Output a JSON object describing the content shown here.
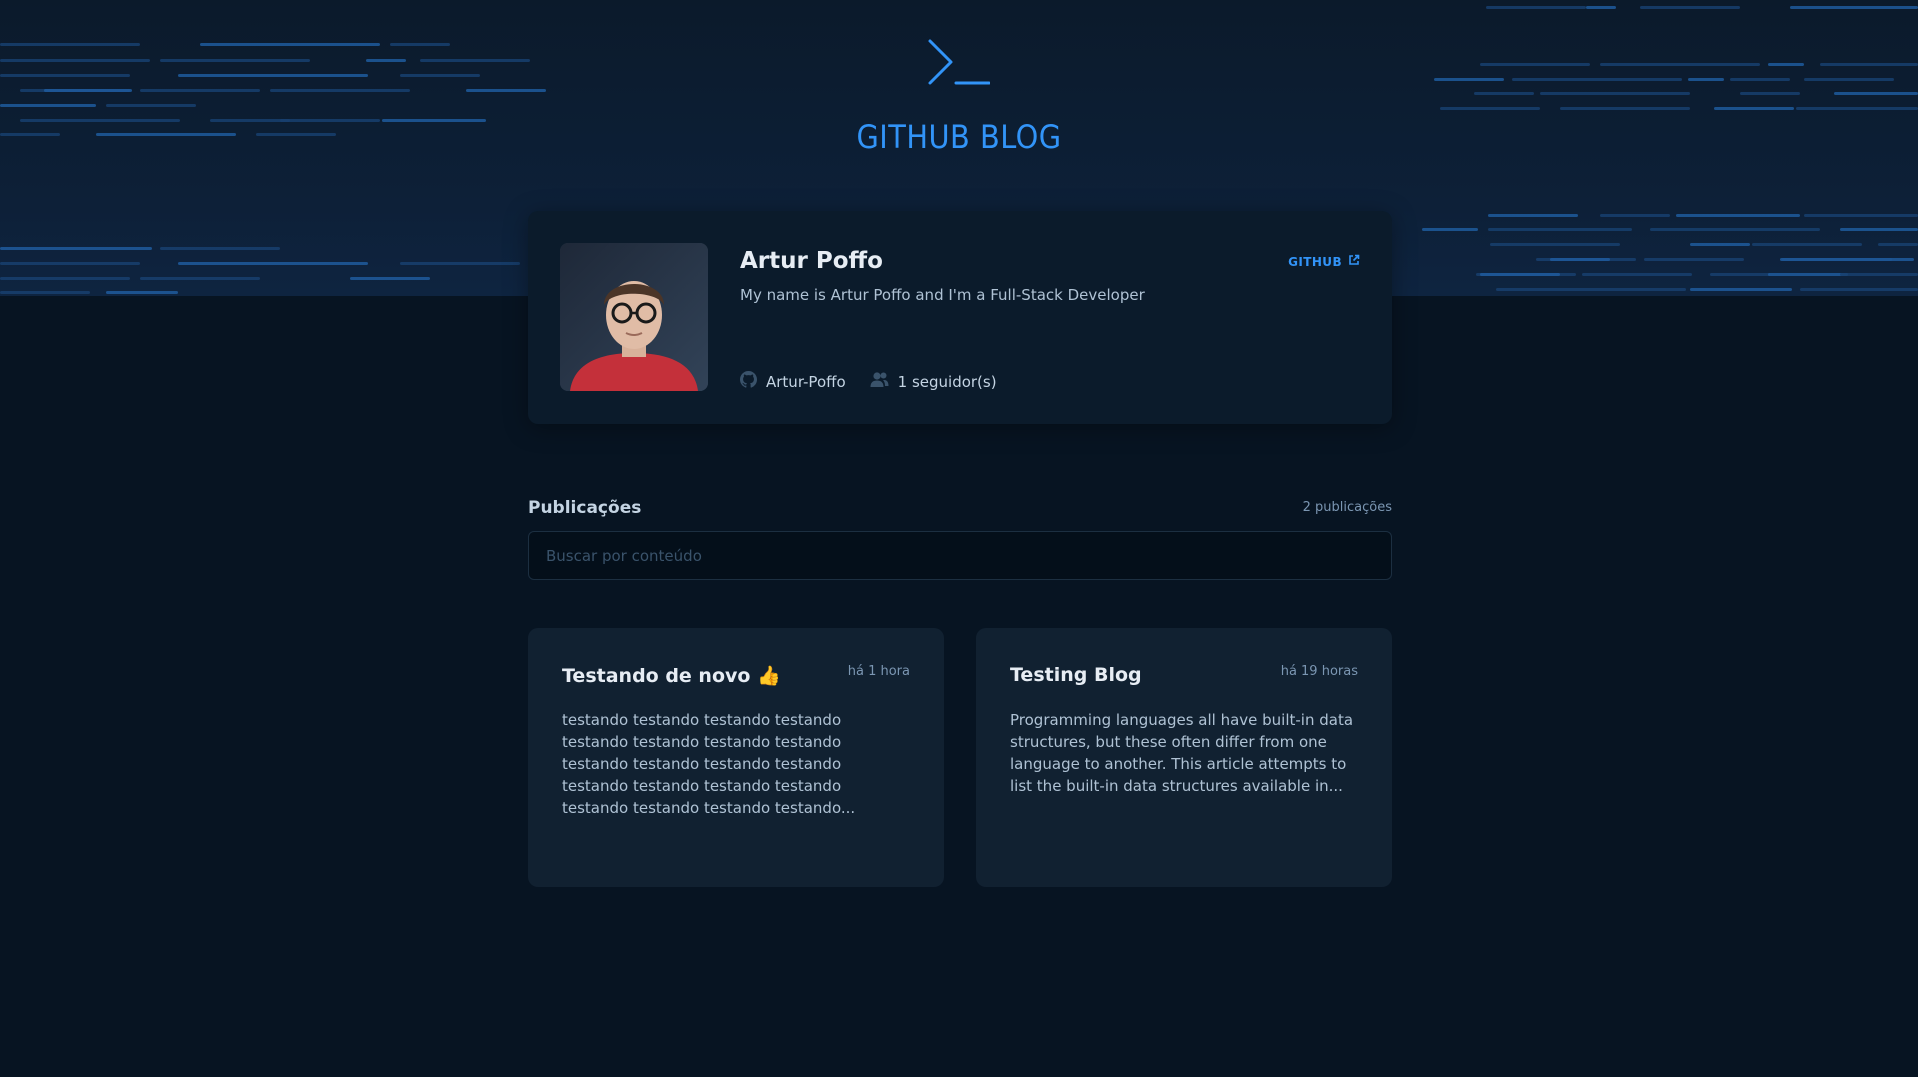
{
  "colors": {
    "background": "#071422",
    "accent": "#3294f8",
    "card": "#112131",
    "profile_card": "#0b1b2b"
  },
  "header": {
    "logo_icon": "terminal-prompt-icon",
    "brand": "GITHUB BLOG"
  },
  "profile": {
    "name": "Artur Poffo",
    "bio": "My name is Artur Poffo and I'm a Full-Stack Developer",
    "link_label": "GITHUB",
    "link_icon": "external-link-icon",
    "username_icon": "github-icon",
    "username": "Artur-Poffo",
    "followers_icon": "users-icon",
    "followers": "1 seguidor(s)"
  },
  "publications": {
    "title": "Publicações",
    "count": "2 publicações",
    "search_placeholder": "Buscar por conteúdo",
    "search_value": "",
    "posts": [
      {
        "title": "Testando de novo 👍",
        "time": "há 1 hora",
        "excerpt": "testando testando testando testando testando testando testando testando testando testando testando testando testando testando testando testando testando testando testando testando..."
      },
      {
        "title": "Testing Blog",
        "time": "há 19 horas",
        "excerpt": "Programming languages all have built-in data structures, but these often differ from one language to another. This article attempts to list the built-in data structures available in..."
      }
    ]
  }
}
